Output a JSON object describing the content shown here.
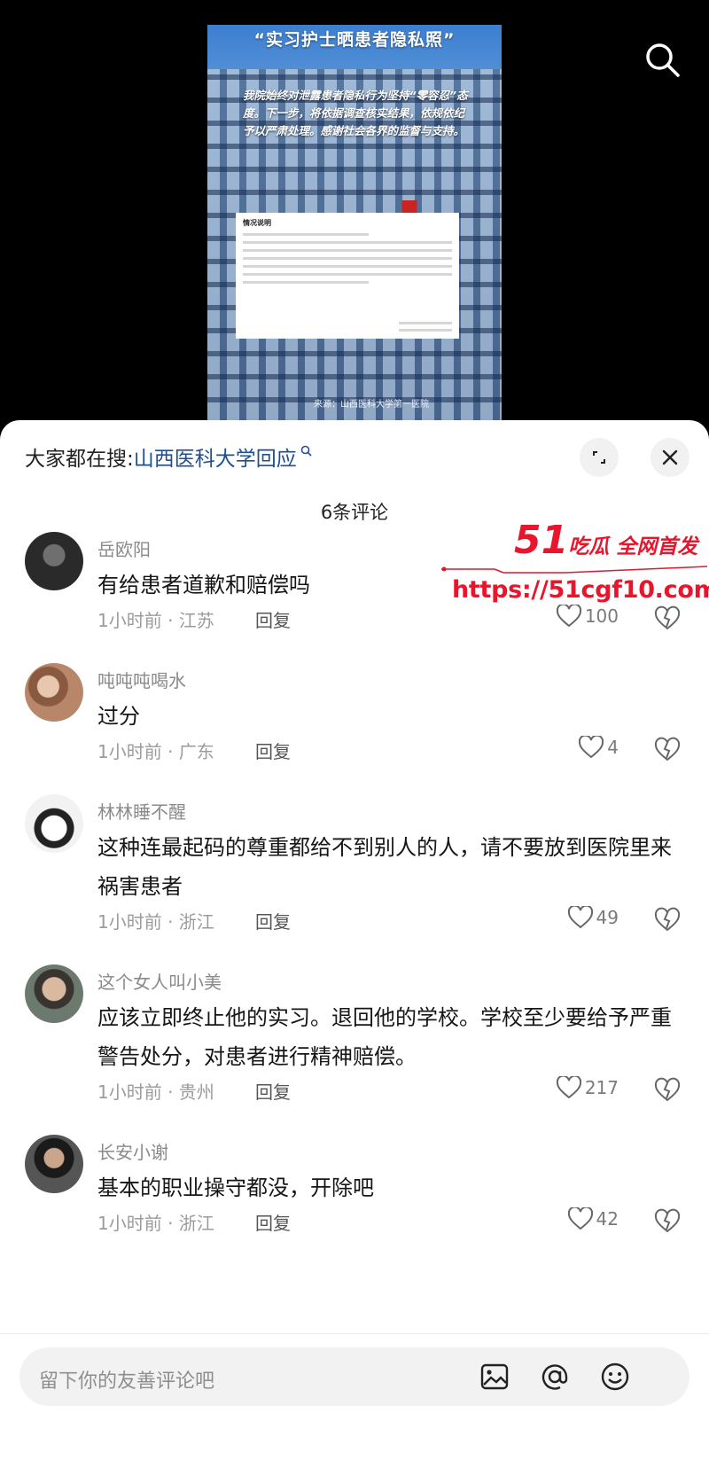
{
  "video": {
    "poster_title": "“实习护士晒患者隐私照”",
    "poster_text": "我院始终对泄露患者隐私行为坚持“零容忍”态度。下一步，将依据调查核实结果，依规依纪予以严肃处理。感谢社会各界的监督与支持。",
    "doc_title": "情况说明",
    "source": "来源：山西医科大学第一医院",
    "search_icon": "search-icon"
  },
  "sheet": {
    "hot_search_label": "大家都在搜:",
    "hot_search_link": "山西医科大学回应",
    "comment_count": "6条评论",
    "expand_icon": "expand-icon",
    "close_icon": "close-icon"
  },
  "watermark": {
    "logo_num": "51",
    "logo_text": "吃瓜 全网首发",
    "url": "https://51cgf10.com"
  },
  "comments": [
    {
      "user": "岳欧阳",
      "text": "有给患者道歉和赔偿吗",
      "meta": "1小时前 · 江苏",
      "reply": "回复",
      "likes": "100"
    },
    {
      "user": "吨吨吨喝水",
      "text": "过分",
      "meta": "1小时前 · 广东",
      "reply": "回复",
      "likes": "4"
    },
    {
      "user": "林林睡不醒",
      "text": "这种连最起码的尊重都给不到别人的人，请不要放到医院里来祸害患者",
      "meta": "1小时前 · 浙江",
      "reply": "回复",
      "likes": "49"
    },
    {
      "user": "这个女人叫小美",
      "text": "应该立即终止他的实习。退回他的学校。学校至少要给予严重警告处分，对患者进行精神赔偿。",
      "meta": "1小时前 · 贵州",
      "reply": "回复",
      "likes": "217"
    },
    {
      "user": "长安小谢",
      "text": "基本的职业操守都没，开除吧",
      "meta": "1小时前 · 浙江",
      "reply": "回复",
      "likes": "42"
    }
  ],
  "input": {
    "placeholder": "留下你的友善评论吧",
    "icons": [
      "image-icon",
      "mention-icon",
      "emoji-icon"
    ]
  },
  "colors": {
    "link": "#1f4f8f",
    "watermark": "#e8152c",
    "meta": "#9b9b9b"
  }
}
